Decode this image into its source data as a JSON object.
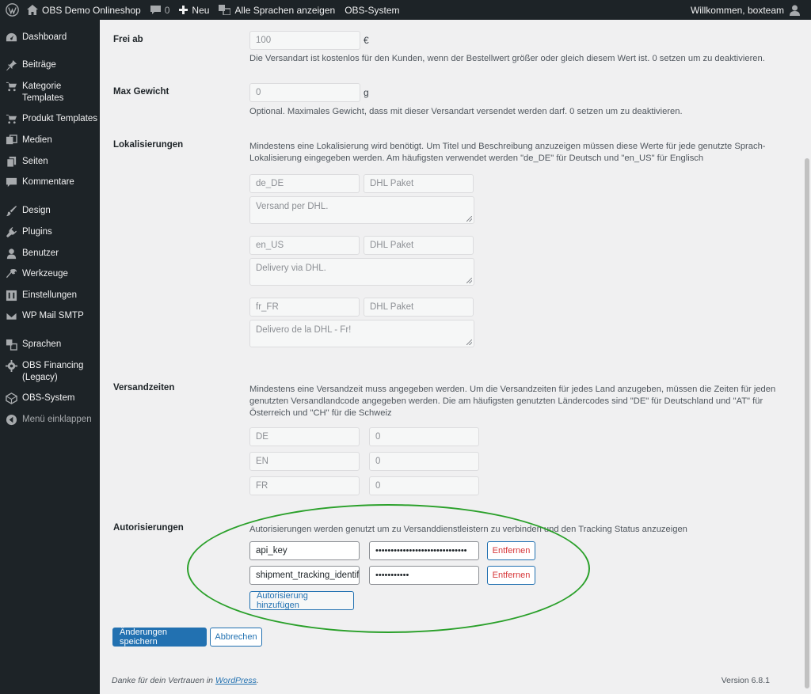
{
  "adminbar": {
    "site_name": "OBS Demo Onlineshop",
    "comments_count": "0",
    "new_label": "Neu",
    "languages_label": "Alle Sprachen anzeigen",
    "obs_label": "OBS-System",
    "welcome": "Willkommen, boxteam"
  },
  "sidebar": {
    "items": [
      {
        "label": "Dashboard",
        "icon": "dashboard-icon"
      },
      {
        "label": "Beiträge",
        "icon": "pin-icon"
      },
      {
        "label": "Kategorie Templates",
        "icon": "cart-icon"
      },
      {
        "label": "Produkt Templates",
        "icon": "cart-icon"
      },
      {
        "label": "Medien",
        "icon": "media-icon"
      },
      {
        "label": "Seiten",
        "icon": "pages-icon"
      },
      {
        "label": "Kommentare",
        "icon": "comment-icon"
      },
      {
        "label": "Design",
        "icon": "brush-icon"
      },
      {
        "label": "Plugins",
        "icon": "plugin-icon"
      },
      {
        "label": "Benutzer",
        "icon": "user-icon"
      },
      {
        "label": "Werkzeuge",
        "icon": "wrench-icon"
      },
      {
        "label": "Einstellungen",
        "icon": "settings-icon"
      },
      {
        "label": "WP Mail SMTP",
        "icon": "mail-icon"
      },
      {
        "label": "Sprachen",
        "icon": "translate-icon"
      },
      {
        "label": "OBS Financing (Legacy)",
        "icon": "gear-icon"
      },
      {
        "label": "OBS-System",
        "icon": "cube-icon"
      },
      {
        "label": "Menü einklappen",
        "icon": "collapse-icon"
      }
    ]
  },
  "form": {
    "free_from": {
      "label": "Frei ab",
      "value": "100",
      "unit": "€",
      "description": "Die Versandart ist kostenlos für den Kunden, wenn der Bestellwert größer oder gleich diesem Wert ist. 0 setzen um zu deaktivieren."
    },
    "max_weight": {
      "label": "Max Gewicht",
      "value": "0",
      "unit": "g",
      "description": "Optional. Maximales Gewicht, dass mit dieser Versandart versendet werden darf. 0 setzen um zu deaktivieren."
    },
    "localizations": {
      "label": "Lokalisierungen",
      "description_1": "Mindestens eine Lokalisierung wird benötigt. Um Titel und Beschreibung anzuzeigen müssen diese Werte für jede genutzte Sprach-",
      "description_2": "Lokalisierung eingegeben werden. Am häufigsten verwendet werden \"de_DE\" für Deutsch und \"en_US\" für Englisch",
      "entries": [
        {
          "locale": "de_DE",
          "title": "DHL Paket",
          "text": "Versand per DHL."
        },
        {
          "locale": "en_US",
          "title": "DHL Paket",
          "text": "Delivery via DHL."
        },
        {
          "locale": "fr_FR",
          "title": "DHL Paket",
          "text": "Delivero de la DHL - Fr!"
        }
      ]
    },
    "delivery_times": {
      "label": "Versandzeiten",
      "description_1": "Mindestens eine Versandzeit muss angegeben werden. Um die Versandzeiten für jedes Land anzugeben, müssen die Zeiten für jeden",
      "description_2": "genutzten Versandlandcode angegeben werden. Die am häufigsten genutzten Ländercodes sind \"DE\" für Deutschland und \"AT\" für",
      "description_3": "Österreich und \"CH\" für die Schweiz",
      "entries": [
        {
          "code": "DE",
          "days": "0"
        },
        {
          "code": "EN",
          "days": "0"
        },
        {
          "code": "FR",
          "days": "0"
        }
      ]
    },
    "authorizations": {
      "label": "Autorisierungen",
      "description": "Autorisierungen werden genutzt um zu Versanddienstleistern zu verbinden und den Tracking Status anzuzeigen",
      "entries": [
        {
          "key": "api_key",
          "secret": "••••••••••••••••••••••••••••••",
          "remove": "Entfernen"
        },
        {
          "key": "shipment_tracking_identif",
          "secret": "•••••••••••",
          "remove": "Entfernen"
        }
      ],
      "add_label": "Autorisierung hinzufügen"
    },
    "save_label": "Änderungen speichern",
    "cancel_label": "Abbrechen"
  },
  "footer": {
    "thanks_prefix": "Danke für dein Vertrauen in",
    "wordpress_link": "WordPress",
    "suffix": ".",
    "version": "Version 6.8.1"
  },
  "colors": {
    "admin_bg": "#1d2327",
    "accent": "#2271b1",
    "danger": "#d63638",
    "highlight": "#2aa02a"
  }
}
